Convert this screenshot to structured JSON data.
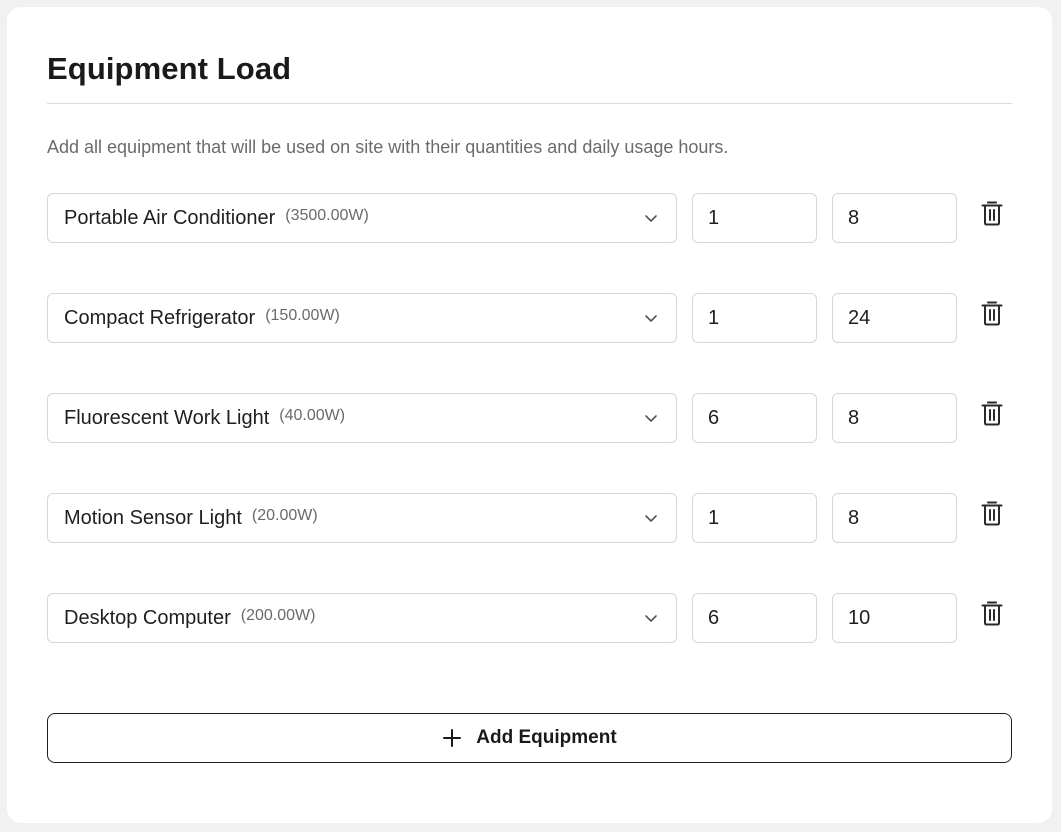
{
  "card": {
    "title": "Equipment Load",
    "description": "Add all equipment that will be used on site with their quantities and daily usage hours."
  },
  "equipment": [
    {
      "name": "Portable Air Conditioner",
      "watts": "(3500.00W)",
      "quantity": "1",
      "hours": "8"
    },
    {
      "name": "Compact Refrigerator",
      "watts": "(150.00W)",
      "quantity": "1",
      "hours": "24"
    },
    {
      "name": "Fluorescent Work Light",
      "watts": "(40.00W)",
      "quantity": "6",
      "hours": "8"
    },
    {
      "name": "Motion Sensor Light",
      "watts": "(20.00W)",
      "quantity": "1",
      "hours": "8"
    },
    {
      "name": "Desktop Computer",
      "watts": "(200.00W)",
      "quantity": "6",
      "hours": "10"
    }
  ],
  "add_button": {
    "label": "Add Equipment",
    "icon": "plus-icon"
  },
  "icons": {
    "dropdown": "chevron-down-icon",
    "delete": "trash-icon"
  },
  "colors": {
    "text": "#1f1f1f",
    "muted": "#6b6b6b",
    "border": "#d6d6d6",
    "background": "#f1f1f1",
    "card": "#ffffff"
  }
}
